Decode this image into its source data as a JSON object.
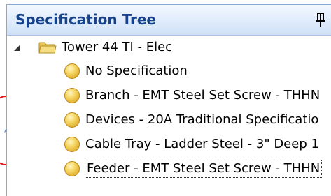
{
  "panel": {
    "title": "Specification Tree"
  },
  "tree": {
    "root": {
      "label": "Tower 44 TI - Elec",
      "expanded": true
    },
    "items": [
      {
        "label": "No Specification",
        "icon": "spec-circle-icon",
        "selected": false
      },
      {
        "label": "Branch - EMT Steel Set Screw - THHN",
        "icon": "spec-circle-icon",
        "selected": false
      },
      {
        "label": "Devices - 20A Traditional Specificatio",
        "icon": "spec-circle-icon",
        "selected": false
      },
      {
        "label": "Cable Tray - Ladder Steel - 3\" Deep 1",
        "icon": "spec-circle-icon",
        "selected": false
      },
      {
        "label": "Feeder - EMT Steel Set Screw - THHN",
        "icon": "spec-circle-icon",
        "selected": true
      }
    ]
  },
  "colors": {
    "title_text": "#15428b",
    "panel_border": "#8aa7cf",
    "annotation": "#e01818"
  }
}
